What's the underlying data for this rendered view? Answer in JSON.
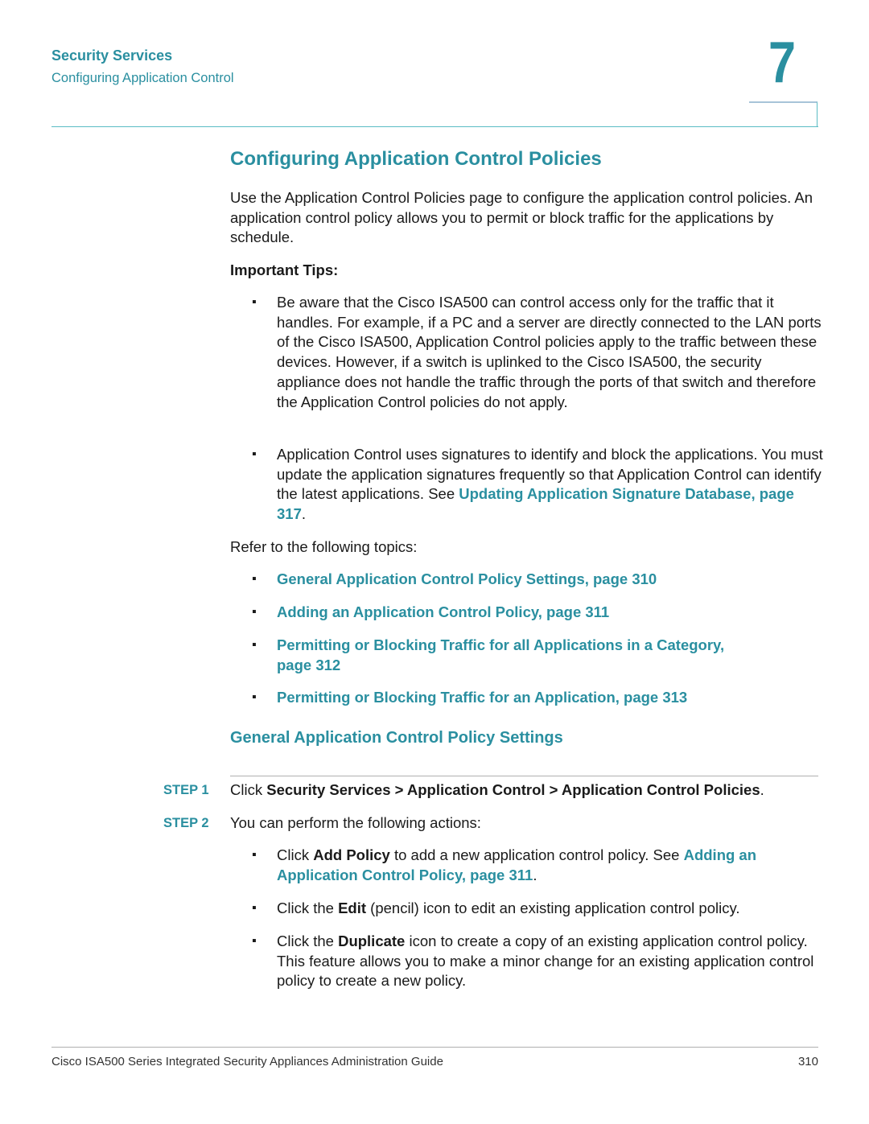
{
  "header": {
    "section": "Security Services",
    "subsection": "Configuring Application Control",
    "chapter_number": "7"
  },
  "main": {
    "title": "Configuring Application Control Policies",
    "intro": "Use the Application Control Policies page to configure the application control policies. An application control policy allows you to permit or block traffic for the applications by schedule.",
    "tips_heading": "Important Tips:",
    "tips": [
      {
        "text": "Be aware that the Cisco ISA500 can control access only for the traffic that it handles. For example, if a PC and a server are directly connected to the LAN ports of the Cisco ISA500, Application Control policies apply to the traffic between these devices. However, if a switch is uplinked to the Cisco ISA500, the security appliance does not handle the traffic through the ports of that switch and therefore the Application Control policies do not apply."
      },
      {
        "text_before": "Application Control uses signatures to identify and block the applications. You must update the application signatures frequently so that Application Control can identify the latest applications. See ",
        "link": "Updating Application Signature Database, page 317",
        "text_after": "."
      }
    ],
    "refer_text": "Refer to the following topics:",
    "topics": [
      "General Application Control Policy Settings, page 310",
      "Adding an Application Control Policy, page 311",
      "Permitting or Blocking Traffic for all Applications in a Category, page 312",
      "Permitting or Blocking Traffic for an Application, page 313"
    ],
    "subheading": "General Application Control Policy Settings",
    "steps": [
      {
        "label": "STEP 1",
        "prefix": "Click ",
        "bold": "Security Services > Application Control > Application Control Policies",
        "suffix": "."
      },
      {
        "label": "STEP 2",
        "text": "You can perform the following actions:"
      }
    ],
    "actions": [
      {
        "prefix": "Click ",
        "bold": "Add Policy",
        "middle": " to add a new application control policy. See ",
        "link": "Adding an Application Control Policy, page 311",
        "suffix": "."
      },
      {
        "prefix": "Click the ",
        "bold": "Edit",
        "suffix": " (pencil) icon to edit an existing application control policy."
      },
      {
        "prefix": "Click the ",
        "bold": "Duplicate",
        "suffix": " icon to create a copy of an existing application control policy. This feature allows you to make a minor change for an existing application control policy to create a new policy."
      }
    ],
    "bullet_glyph": "▪"
  },
  "footer": {
    "guide_title": "Cisco ISA500 Series Integrated Security Appliances Administration Guide",
    "page_number": "310"
  },
  "colors": {
    "accent": "#2a8fa0",
    "rule": "#5bbcc4"
  }
}
